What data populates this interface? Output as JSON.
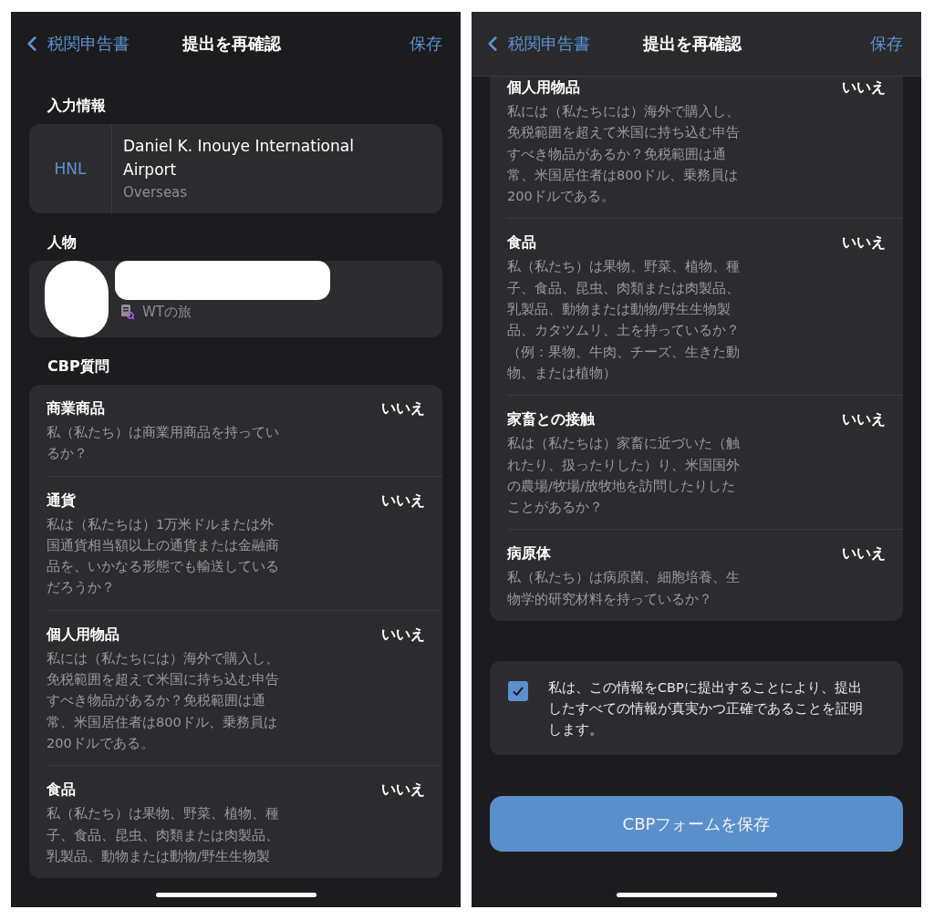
{
  "screens": [
    {
      "nav": {
        "back": "税関申告書",
        "title": "提出を再確認",
        "action": "保存",
        "scrolled": false
      },
      "sections": [
        {
          "kind": "entry",
          "header": "入力情報",
          "code": "HNL",
          "name": "Daniel K. Inouye International Airport",
          "region": "Overseas"
        },
        {
          "kind": "person",
          "header": "人物",
          "trip": "WTの旅"
        },
        {
          "kind": "questions",
          "header": "CBP質問",
          "items": [
            {
              "title": "商業商品",
              "answer": "いいえ",
              "description": "私（私たち）は商業用商品を持っているか？"
            },
            {
              "title": "通貨",
              "answer": "いいえ",
              "description": "私は（私たちは）1万米ドルまたは外国通貨相当額以上の通貨または金融商品を、いかなる形態でも輸送しているだろうか？"
            },
            {
              "title": "個人用物品",
              "answer": "いいえ",
              "description": "私には（私たちには）海外で購入し、免税範囲を超えて米国に持ち込む申告すべき物品があるか？免税範囲は通常、米国居住者は800ドル、乗務員は200ドルである。"
            },
            {
              "title": "食品",
              "answer": "いいえ",
              "description": "私（私たち）は果物、野菜、植物、種子、食品、昆虫、肉類または肉製品、乳製品、動物または動物/野生生物製"
            }
          ]
        }
      ]
    },
    {
      "nav": {
        "back": "税関申告書",
        "title": "提出を再確認",
        "action": "保存",
        "scrolled": true
      },
      "sections": [
        {
          "kind": "questions",
          "items": [
            {
              "title": "個人用物品",
              "answer": "いいえ",
              "description": "私には（私たちには）海外で購入し、免税範囲を超えて米国に持ち込む申告すべき物品があるか？免税範囲は通常、米国居住者は800ドル、乗務員は200ドルである。"
            },
            {
              "title": "食品",
              "answer": "いいえ",
              "description": "私（私たち）は果物、野菜、植物、種子、食品、昆虫、肉類または肉製品、乳製品、動物または動物/野生生物製品、カタツムリ、土を持っているか？（例：果物、牛肉、チーズ、生きた動物、または植物）"
            },
            {
              "title": "家畜との接触",
              "answer": "いいえ",
              "description": "私は（私たちは）家畜に近づいた（触れたり、扱ったりした）り、米国国外の農場/牧場/放牧地を訪問したりしたことがあるか？"
            },
            {
              "title": "病原体",
              "answer": "いいえ",
              "description": "私（私たち）は病原菌、細胞培養、生物学的研究材料を持っているか？"
            }
          ]
        },
        {
          "kind": "certification",
          "checked": true,
          "text": "私は、この情報をCBPに提出することにより、提出したすべての情報が真実かつ正確であることを証明します。"
        },
        {
          "kind": "button",
          "label": "CBPフォームを保存"
        }
      ]
    }
  ]
}
